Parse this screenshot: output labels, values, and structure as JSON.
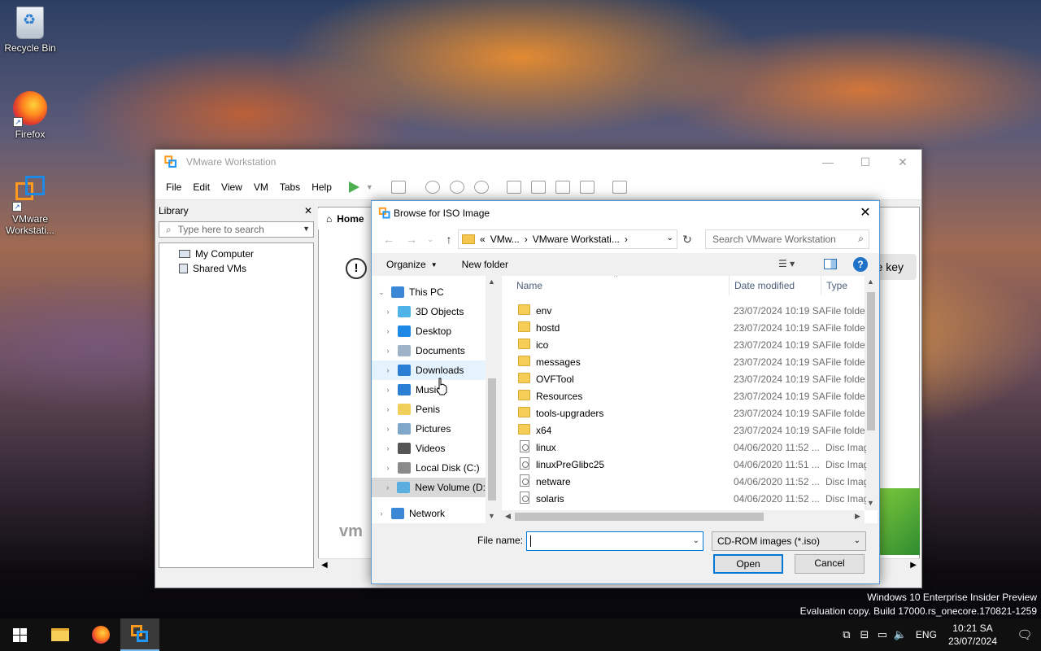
{
  "desktop": {
    "icons": [
      {
        "label": "Recycle Bin"
      },
      {
        "label": "Firefox"
      },
      {
        "label": "VMware Workstati..."
      }
    ],
    "watermark": {
      "line1": "Windows 10 Enterprise Insider Preview",
      "line2": "Evaluation copy. Build 17000.rs_onecore.170821-1259"
    }
  },
  "vmware": {
    "title": "VMware Workstation",
    "window_controls": {
      "minimize": "—",
      "maximize": "☐",
      "close": "✕"
    },
    "menu": [
      "File",
      "Edit",
      "View",
      "VM",
      "Tabs",
      "Help"
    ],
    "library": {
      "title": "Library",
      "close": "✕",
      "search_placeholder": "Type here to search",
      "tree": [
        "My Computer",
        "Shared VMs"
      ]
    },
    "home_tab": "Home",
    "key_button": "e key",
    "info_glyph": "!",
    "brand_fragment": "vm"
  },
  "dialog": {
    "title": "Browse for ISO Image",
    "close": "✕",
    "address": {
      "prefix": "«",
      "part1": "VMw...",
      "sep": "›",
      "part2": "VMware Workstati...",
      "sep2": "›"
    },
    "search_placeholder": "Search VMware Workstation",
    "toolbar": {
      "organize": "Organize",
      "new_folder": "New folder",
      "help": "?"
    },
    "nav": [
      {
        "label": "This PC",
        "icon": "this-pc-icon",
        "color": "#3a87d6",
        "expanded": true
      },
      {
        "label": "3D Objects",
        "icon": "3d-objects-icon",
        "color": "#4fb3e8"
      },
      {
        "label": "Desktop",
        "icon": "desktop-icon",
        "color": "#1e88e5"
      },
      {
        "label": "Documents",
        "icon": "documents-icon",
        "color": "#9fb3c8"
      },
      {
        "label": "Downloads",
        "icon": "downloads-icon",
        "color": "#2a7fd4"
      },
      {
        "label": "Music",
        "icon": "music-icon",
        "color": "#2a7fd4"
      },
      {
        "label": "Penis",
        "icon": "user-folder-icon",
        "color": "#f1cf5b"
      },
      {
        "label": "Pictures",
        "icon": "pictures-icon",
        "color": "#7fa7c9"
      },
      {
        "label": "Videos",
        "icon": "videos-icon",
        "color": "#555555"
      },
      {
        "label": "Local Disk (C:)",
        "icon": "local-disk-icon",
        "color": "#8a8a8a"
      },
      {
        "label": "New Volume (D:",
        "icon": "volume-icon",
        "color": "#5aaee0"
      },
      {
        "label": "Network",
        "icon": "network-icon",
        "color": "#3a87d6"
      }
    ],
    "columns": {
      "name": "Name",
      "date": "Date modified",
      "type": "Type"
    },
    "files": [
      {
        "name": "env",
        "date": "23/07/2024 10:19 SA",
        "type": "File folde",
        "kind": "folder"
      },
      {
        "name": "hostd",
        "date": "23/07/2024 10:19 SA",
        "type": "File folde",
        "kind": "folder"
      },
      {
        "name": "ico",
        "date": "23/07/2024 10:19 SA",
        "type": "File folde",
        "kind": "folder"
      },
      {
        "name": "messages",
        "date": "23/07/2024 10:19 SA",
        "type": "File folde",
        "kind": "folder"
      },
      {
        "name": "OVFTool",
        "date": "23/07/2024 10:19 SA",
        "type": "File folde",
        "kind": "folder"
      },
      {
        "name": "Resources",
        "date": "23/07/2024 10:19 SA",
        "type": "File folde",
        "kind": "folder"
      },
      {
        "name": "tools-upgraders",
        "date": "23/07/2024 10:19 SA",
        "type": "File folde",
        "kind": "folder"
      },
      {
        "name": "x64",
        "date": "23/07/2024 10:19 SA",
        "type": "File folde",
        "kind": "folder"
      },
      {
        "name": "linux",
        "date": "04/06/2020 11:52 ...",
        "type": "Disc Imag",
        "kind": "disc"
      },
      {
        "name": "linuxPreGlibc25",
        "date": "04/06/2020 11:51 ...",
        "type": "Disc Imag",
        "kind": "disc"
      },
      {
        "name": "netware",
        "date": "04/06/2020 11:52 ...",
        "type": "Disc Imag",
        "kind": "disc"
      },
      {
        "name": "solaris",
        "date": "04/06/2020 11:52 ...",
        "type": "Disc Imag",
        "kind": "disc"
      }
    ],
    "file_name_label": "File name:",
    "file_name_value": "",
    "file_type": "CD-ROM images (*.iso)",
    "open": "Open",
    "cancel": "Cancel"
  },
  "taskbar": {
    "lang": "ENG",
    "time": "10:21 SA",
    "date": "23/07/2024"
  }
}
